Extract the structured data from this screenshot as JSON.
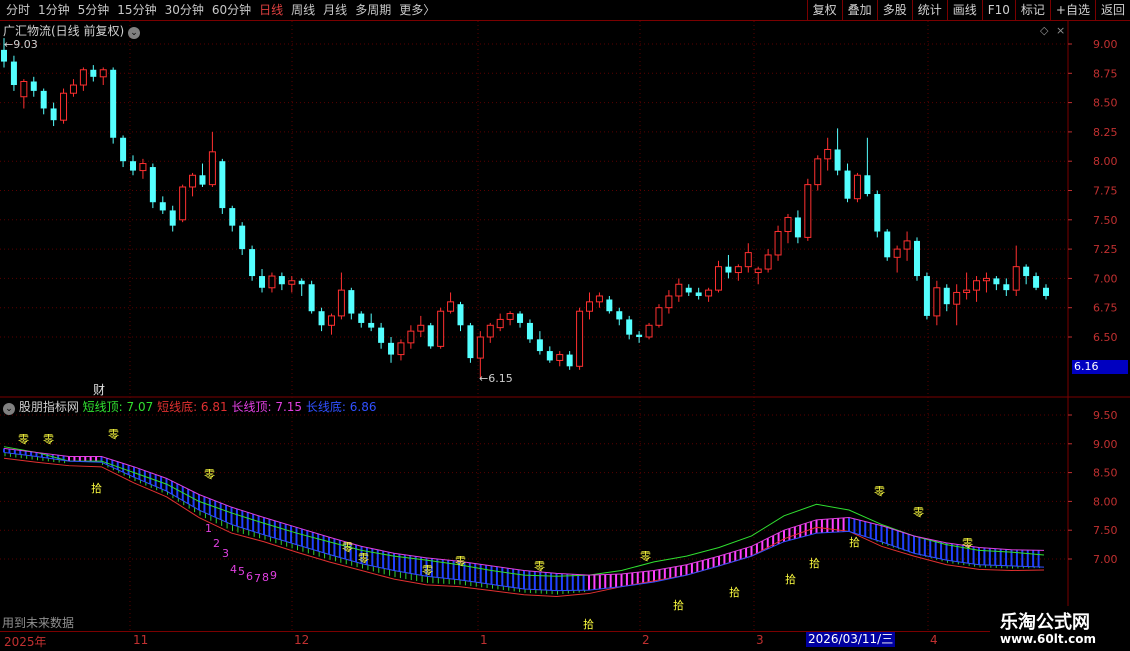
{
  "toolbar": {
    "periods": [
      "分时",
      "1分钟",
      "5分钟",
      "15分钟",
      "30分钟",
      "60分钟",
      "日线",
      "周线",
      "月线",
      "多周期",
      "更多"
    ],
    "active_period": "日线",
    "more_arrow": "〉",
    "right_buttons": [
      "复权",
      "叠加",
      "多股",
      "统计",
      "画线",
      "F10",
      "标记",
      "+自选",
      "返回"
    ]
  },
  "stock": {
    "title": "广汇物流(日线 前复权)",
    "high_label": "9.03",
    "low_label": "6.15",
    "current_price": "6.16",
    "fin_marker": "财"
  },
  "price_axis": [
    "9.00",
    "8.75",
    "8.50",
    "8.25",
    "8.00",
    "7.75",
    "7.50",
    "7.25",
    "7.00",
    "6.75",
    "6.50"
  ],
  "indicator": {
    "name": "股朋指标网",
    "params": [
      {
        "label": "短线顶: 7.07",
        "color": "#30e030"
      },
      {
        "label": "短线底: 6.81",
        "color": "#e03030"
      },
      {
        "label": "长线顶: 7.15",
        "color": "#e040e0"
      },
      {
        "label": "长线底: 6.86",
        "color": "#3050ff"
      }
    ],
    "axis": [
      "9.50",
      "9.00",
      "8.50",
      "8.00",
      "7.50",
      "7.00"
    ]
  },
  "annotations": {
    "zero": "零",
    "ten": "拾",
    "sequence": [
      "1",
      "2",
      "3",
      "4",
      "5",
      "6",
      "7",
      "8",
      "9"
    ]
  },
  "future_note": "用到未来数据",
  "dates": {
    "labels": [
      "2025年",
      "11",
      "12",
      "1",
      "2",
      "3",
      "4"
    ],
    "highlight": "2026/03/11/三"
  },
  "colors": {
    "up": "#ff3030",
    "down": "#54ffff",
    "grid_red": "#7a0000",
    "zero_color": "#ffff40",
    "seq_color": "#e040e0"
  },
  "logo": {
    "title": "乐淘公式网",
    "url": "www.60lt.com"
  },
  "chart_data": {
    "type": "candlestick",
    "price_range": [
      6.15,
      9.03
    ],
    "candles": [
      [
        8.95,
        9.05,
        8.8,
        8.85
      ],
      [
        8.85,
        8.9,
        8.6,
        8.65
      ],
      [
        8.55,
        8.7,
        8.45,
        8.68
      ],
      [
        8.68,
        8.72,
        8.55,
        8.6
      ],
      [
        8.6,
        8.62,
        8.4,
        8.45
      ],
      [
        8.45,
        8.5,
        8.3,
        8.35
      ],
      [
        8.35,
        8.62,
        8.32,
        8.58
      ],
      [
        8.58,
        8.7,
        8.55,
        8.65
      ],
      [
        8.65,
        8.8,
        8.6,
        8.78
      ],
      [
        8.78,
        8.82,
        8.68,
        8.72
      ],
      [
        8.72,
        8.8,
        8.65,
        8.78
      ],
      [
        8.78,
        8.8,
        8.15,
        8.2
      ],
      [
        8.2,
        8.22,
        7.95,
        8.0
      ],
      [
        8.0,
        8.05,
        7.88,
        7.92
      ],
      [
        7.92,
        8.02,
        7.85,
        7.98
      ],
      [
        7.95,
        7.98,
        7.6,
        7.65
      ],
      [
        7.65,
        7.7,
        7.55,
        7.58
      ],
      [
        7.58,
        7.62,
        7.4,
        7.45
      ],
      [
        7.5,
        7.8,
        7.48,
        7.78
      ],
      [
        7.78,
        7.9,
        7.7,
        7.88
      ],
      [
        7.88,
        7.98,
        7.78,
        7.8
      ],
      [
        7.8,
        8.25,
        7.78,
        8.08
      ],
      [
        8.0,
        8.02,
        7.55,
        7.6
      ],
      [
        7.6,
        7.62,
        7.4,
        7.45
      ],
      [
        7.45,
        7.48,
        7.2,
        7.25
      ],
      [
        7.25,
        7.28,
        6.98,
        7.02
      ],
      [
        7.02,
        7.08,
        6.88,
        6.92
      ],
      [
        6.92,
        7.05,
        6.88,
        7.02
      ],
      [
        7.02,
        7.05,
        6.9,
        6.95
      ],
      [
        6.95,
        7.02,
        6.88,
        6.98
      ],
      [
        6.98,
        7.0,
        6.85,
        6.95
      ],
      [
        6.95,
        6.98,
        6.7,
        6.72
      ],
      [
        6.72,
        6.75,
        6.55,
        6.6
      ],
      [
        6.6,
        6.7,
        6.52,
        6.68
      ],
      [
        6.68,
        7.05,
        6.65,
        6.9
      ],
      [
        6.9,
        6.92,
        6.65,
        6.7
      ],
      [
        6.7,
        6.72,
        6.58,
        6.62
      ],
      [
        6.62,
        6.7,
        6.55,
        6.58
      ],
      [
        6.58,
        6.62,
        6.4,
        6.45
      ],
      [
        6.45,
        6.5,
        6.28,
        6.35
      ],
      [
        6.35,
        6.48,
        6.3,
        6.45
      ],
      [
        6.45,
        6.6,
        6.4,
        6.55
      ],
      [
        6.55,
        6.68,
        6.5,
        6.6
      ],
      [
        6.6,
        6.62,
        6.4,
        6.42
      ],
      [
        6.42,
        6.75,
        6.4,
        6.72
      ],
      [
        6.72,
        6.88,
        6.7,
        6.8
      ],
      [
        6.78,
        6.8,
        6.55,
        6.6
      ],
      [
        6.6,
        6.62,
        6.28,
        6.32
      ],
      [
        6.32,
        6.55,
        6.15,
        6.5
      ],
      [
        6.5,
        6.62,
        6.45,
        6.6
      ],
      [
        6.58,
        6.7,
        6.55,
        6.65
      ],
      [
        6.65,
        6.72,
        6.6,
        6.7
      ],
      [
        6.7,
        6.72,
        6.58,
        6.62
      ],
      [
        6.62,
        6.65,
        6.45,
        6.48
      ],
      [
        6.48,
        6.55,
        6.35,
        6.38
      ],
      [
        6.38,
        6.42,
        6.28,
        6.3
      ],
      [
        6.3,
        6.38,
        6.25,
        6.35
      ],
      [
        6.35,
        6.38,
        6.22,
        6.25
      ],
      [
        6.25,
        6.75,
        6.22,
        6.72
      ],
      [
        6.72,
        6.88,
        6.65,
        6.8
      ],
      [
        6.8,
        6.88,
        6.75,
        6.85
      ],
      [
        6.82,
        6.85,
        6.7,
        6.72
      ],
      [
        6.72,
        6.75,
        6.6,
        6.65
      ],
      [
        6.65,
        6.68,
        6.48,
        6.52
      ],
      [
        6.52,
        6.55,
        6.45,
        6.5
      ],
      [
        6.5,
        6.62,
        6.48,
        6.6
      ],
      [
        6.6,
        6.78,
        6.58,
        6.75
      ],
      [
        6.75,
        6.9,
        6.7,
        6.85
      ],
      [
        6.85,
        7.0,
        6.8,
        6.95
      ],
      [
        6.92,
        6.95,
        6.85,
        6.88
      ],
      [
        6.88,
        6.92,
        6.82,
        6.85
      ],
      [
        6.85,
        6.92,
        6.8,
        6.9
      ],
      [
        6.9,
        7.15,
        6.88,
        7.1
      ],
      [
        7.1,
        7.2,
        7.0,
        7.05
      ],
      [
        7.05,
        7.12,
        6.98,
        7.1
      ],
      [
        7.1,
        7.3,
        7.05,
        7.22
      ],
      [
        7.05,
        7.1,
        6.95,
        7.08
      ],
      [
        7.08,
        7.25,
        7.05,
        7.2
      ],
      [
        7.2,
        7.45,
        7.15,
        7.4
      ],
      [
        7.4,
        7.55,
        7.3,
        7.52
      ],
      [
        7.52,
        7.58,
        7.3,
        7.35
      ],
      [
        7.35,
        7.85,
        7.32,
        7.8
      ],
      [
        7.8,
        8.05,
        7.75,
        8.02
      ],
      [
        8.02,
        8.2,
        7.92,
        8.1
      ],
      [
        8.1,
        8.28,
        7.88,
        7.92
      ],
      [
        7.92,
        7.98,
        7.65,
        7.68
      ],
      [
        7.68,
        7.9,
        7.65,
        7.88
      ],
      [
        7.88,
        8.2,
        7.7,
        7.72
      ],
      [
        7.72,
        7.75,
        7.35,
        7.4
      ],
      [
        7.4,
        7.42,
        7.15,
        7.18
      ],
      [
        7.18,
        7.28,
        7.05,
        7.25
      ],
      [
        7.25,
        7.4,
        7.15,
        7.32
      ],
      [
        7.32,
        7.35,
        6.98,
        7.02
      ],
      [
        7.02,
        7.05,
        6.65,
        6.68
      ],
      [
        6.68,
        6.98,
        6.6,
        6.92
      ],
      [
        6.92,
        6.95,
        6.72,
        6.78
      ],
      [
        6.78,
        6.95,
        6.6,
        6.88
      ],
      [
        6.88,
        7.05,
        6.82,
        6.9
      ],
      [
        6.9,
        7.02,
        6.8,
        6.98
      ],
      [
        6.98,
        7.05,
        6.88,
        7.0
      ],
      [
        7.0,
        7.02,
        6.9,
        6.95
      ],
      [
        6.95,
        7.0,
        6.85,
        6.9
      ],
      [
        6.9,
        7.28,
        6.85,
        7.1
      ],
      [
        7.1,
        7.12,
        6.95,
        7.02
      ],
      [
        7.02,
        7.05,
        6.9,
        6.92
      ],
      [
        6.92,
        6.95,
        6.82,
        6.85
      ]
    ],
    "series": [
      {
        "name": "短线顶",
        "color": "#30e030",
        "values": [
          8.95,
          8.85,
          8.7,
          8.7,
          8.5,
          8.3,
          8.0,
          7.8,
          7.62,
          7.45,
          7.3,
          7.15,
          7.05,
          6.98,
          6.9,
          6.8,
          6.72,
          6.7,
          6.72,
          6.8,
          6.95,
          7.05,
          7.2,
          7.4,
          7.75,
          7.95,
          7.85,
          7.6,
          7.4,
          7.25,
          7.15,
          7.12,
          7.07
        ]
      },
      {
        "name": "短线底",
        "color": "#e03030",
        "values": [
          8.75,
          8.68,
          8.62,
          8.6,
          8.32,
          8.08,
          7.72,
          7.45,
          7.3,
          7.12,
          6.95,
          6.8,
          6.65,
          6.55,
          6.52,
          6.45,
          6.38,
          6.35,
          6.4,
          6.52,
          6.62,
          6.72,
          6.88,
          7.05,
          7.35,
          7.55,
          7.48,
          7.22,
          7.05,
          6.9,
          6.82,
          6.8,
          6.81
        ]
      },
      {
        "name": "长线顶",
        "color": "#e040e0",
        "values": [
          8.92,
          8.85,
          8.78,
          8.78,
          8.6,
          8.4,
          8.12,
          7.9,
          7.72,
          7.55,
          7.38,
          7.22,
          7.1,
          7.02,
          6.96,
          6.88,
          6.8,
          6.75,
          6.72,
          6.74,
          6.8,
          6.9,
          7.05,
          7.22,
          7.5,
          7.68,
          7.72,
          7.58,
          7.4,
          7.28,
          7.2,
          7.16,
          7.15
        ]
      },
      {
        "name": "长线底",
        "color": "#3050ff",
        "values": [
          8.85,
          8.78,
          8.7,
          8.68,
          8.42,
          8.18,
          7.85,
          7.6,
          7.42,
          7.25,
          7.08,
          6.92,
          6.8,
          6.7,
          6.64,
          6.56,
          6.48,
          6.45,
          6.46,
          6.52,
          6.6,
          6.72,
          6.88,
          7.05,
          7.3,
          7.45,
          7.48,
          7.3,
          7.1,
          6.98,
          6.9,
          6.88,
          6.86
        ]
      }
    ]
  }
}
